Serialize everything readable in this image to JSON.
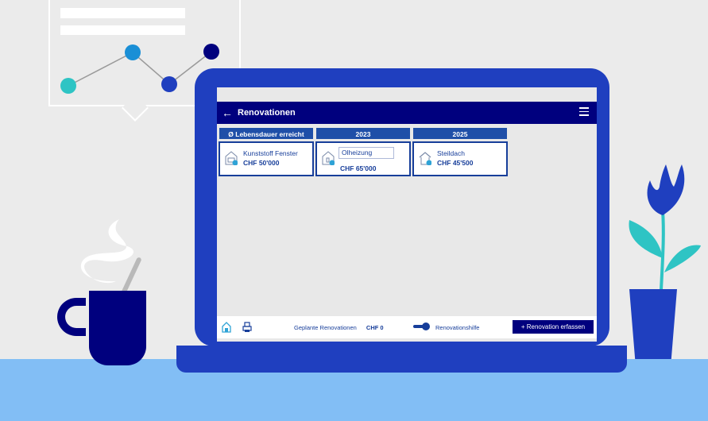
{
  "app": {
    "title": "Renovationen",
    "back_icon": "arrow-left-icon",
    "menu_icon": "hamburger-icon"
  },
  "columns": [
    {
      "header": "Ø Lebensdauer erreicht",
      "card": {
        "name": "Kunststoff Fenster",
        "cost": "CHF 50'000",
        "icon": "window-icon",
        "editing": false
      }
    },
    {
      "header": "2023",
      "card": {
        "name": "Olheizung",
        "cost": "CHF 65'000",
        "icon": "heating-icon",
        "editing": true
      }
    },
    {
      "header": "2025",
      "card": {
        "name": "Steildach",
        "cost": "CHF 45'500",
        "icon": "roof-icon",
        "editing": false
      }
    }
  ],
  "footer": {
    "planned_label": "Geplante Renovationen",
    "planned_value": "CHF 0",
    "toggle_label": "Renovationshilfe",
    "toggle_on": true,
    "add_button": "+ Renovation erfassen"
  },
  "colors": {
    "header_bg": "#00007e",
    "column_head_bg": "#1f4fa8",
    "card_border": "#173e9a",
    "laptop": "#1f3fbf",
    "desk": "#82bef5",
    "check": "#2fa3d6"
  }
}
